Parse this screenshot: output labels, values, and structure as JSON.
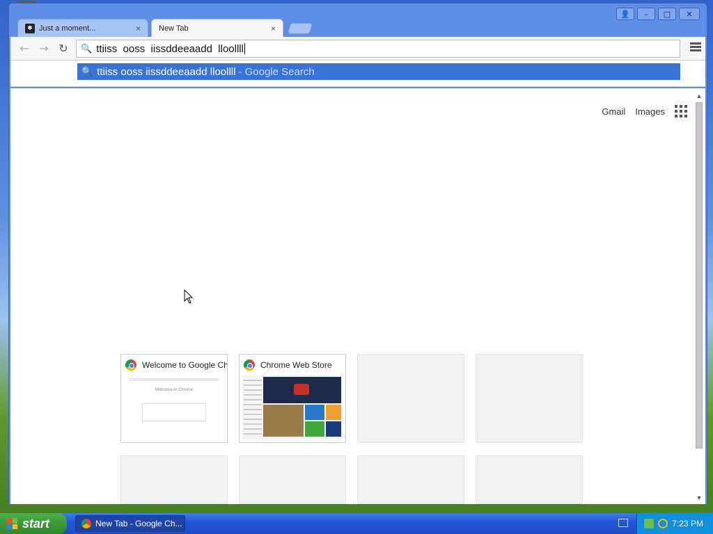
{
  "tabs": [
    {
      "title": "Just a moment...",
      "close": "×",
      "active": false
    },
    {
      "title": "New Tab",
      "close": "×",
      "active": true
    }
  ],
  "window_controls": {
    "user": "👤",
    "minimize": "–",
    "maximize": "□",
    "close": "✕"
  },
  "toolbar": {
    "back": "←",
    "forward": "→",
    "reload": "↻"
  },
  "omnibox": {
    "value": "ttiiss  ooss  iissddeeaadd  lloollll"
  },
  "suggestion": {
    "query": "ttiiss ooss iissddeeaadd lloollll",
    "suffix": "- Google Search"
  },
  "ntp": {
    "links": {
      "gmail": "Gmail",
      "images": "Images"
    },
    "tiles": [
      {
        "title": "Welcome to Google Chrome",
        "thumb_text": "Welcome to Chrome"
      },
      {
        "title": "Chrome Web Store"
      }
    ]
  },
  "scrollbar": {
    "up": "▲",
    "down": "▼"
  },
  "taskbar": {
    "start_label": "start",
    "task_label": "New Tab - Google Ch...",
    "clock": "7:23 PM"
  }
}
